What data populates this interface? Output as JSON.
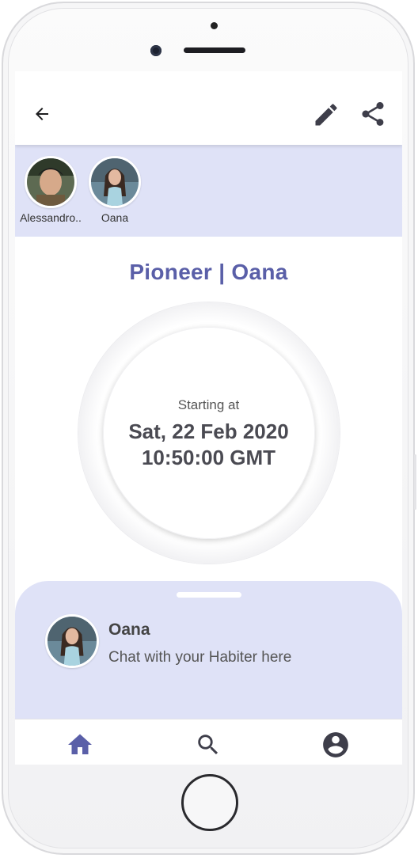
{
  "header": {
    "back_icon": "arrow-left-icon",
    "edit_icon": "pencil-icon",
    "share_icon": "share-icon"
  },
  "members": [
    {
      "name": "Alessandro..",
      "avatar": "person-avatar"
    },
    {
      "name": "Oana",
      "avatar": "person-avatar"
    }
  ],
  "habit": {
    "title": "Pioneer | Oana",
    "starting_label": "Starting at",
    "date": "Sat, 22 Feb 2020",
    "time": "10:50:00 GMT"
  },
  "chat": {
    "name": "Oana",
    "subtitle": "Chat with your Habiter here"
  },
  "nav": {
    "items": [
      {
        "icon": "home-icon",
        "active": true
      },
      {
        "icon": "search-icon",
        "active": false
      },
      {
        "icon": "account-icon",
        "active": false
      }
    ]
  },
  "colors": {
    "accent": "#5a5fa8",
    "panel": "#dfe2f7",
    "icon_dark": "#3e3e4a"
  }
}
